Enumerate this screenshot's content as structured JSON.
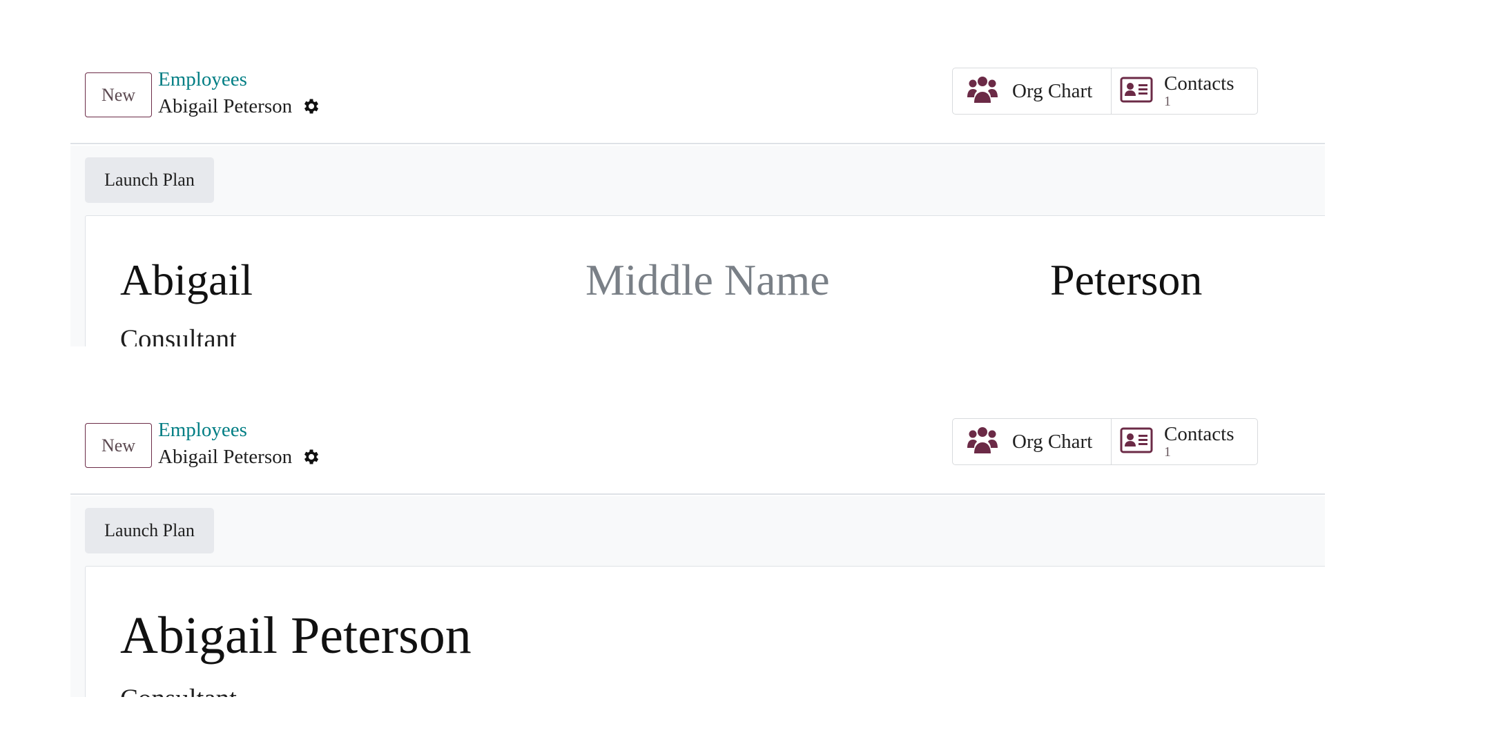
{
  "views": [
    {
      "new_label": "New",
      "breadcrumb_parent": "Employees",
      "breadcrumb_current": "Abigail Peterson",
      "smart_buttons": {
        "org_chart": "Org Chart",
        "contacts": "Contacts",
        "contacts_count": "1"
      },
      "launch_plan": "Launch Plan",
      "first_name": "Abigail",
      "middle_name_placeholder": "Middle Name",
      "last_name": "Peterson",
      "job_title": "Consultant"
    },
    {
      "new_label": "New",
      "breadcrumb_parent": "Employees",
      "breadcrumb_current": "Abigail Peterson",
      "smart_buttons": {
        "org_chart": "Org Chart",
        "contacts": "Contacts",
        "contacts_count": "1"
      },
      "launch_plan": "Launch Plan",
      "full_name": "Abigail Peterson",
      "job_title": "Consultant"
    }
  ],
  "icons": {
    "org_chart": "users-icon",
    "contacts": "id-card-icon",
    "settings": "gear-icon"
  },
  "colors": {
    "link": "#017e84",
    "brand": "#714b67",
    "icon": "#6b2a46"
  }
}
